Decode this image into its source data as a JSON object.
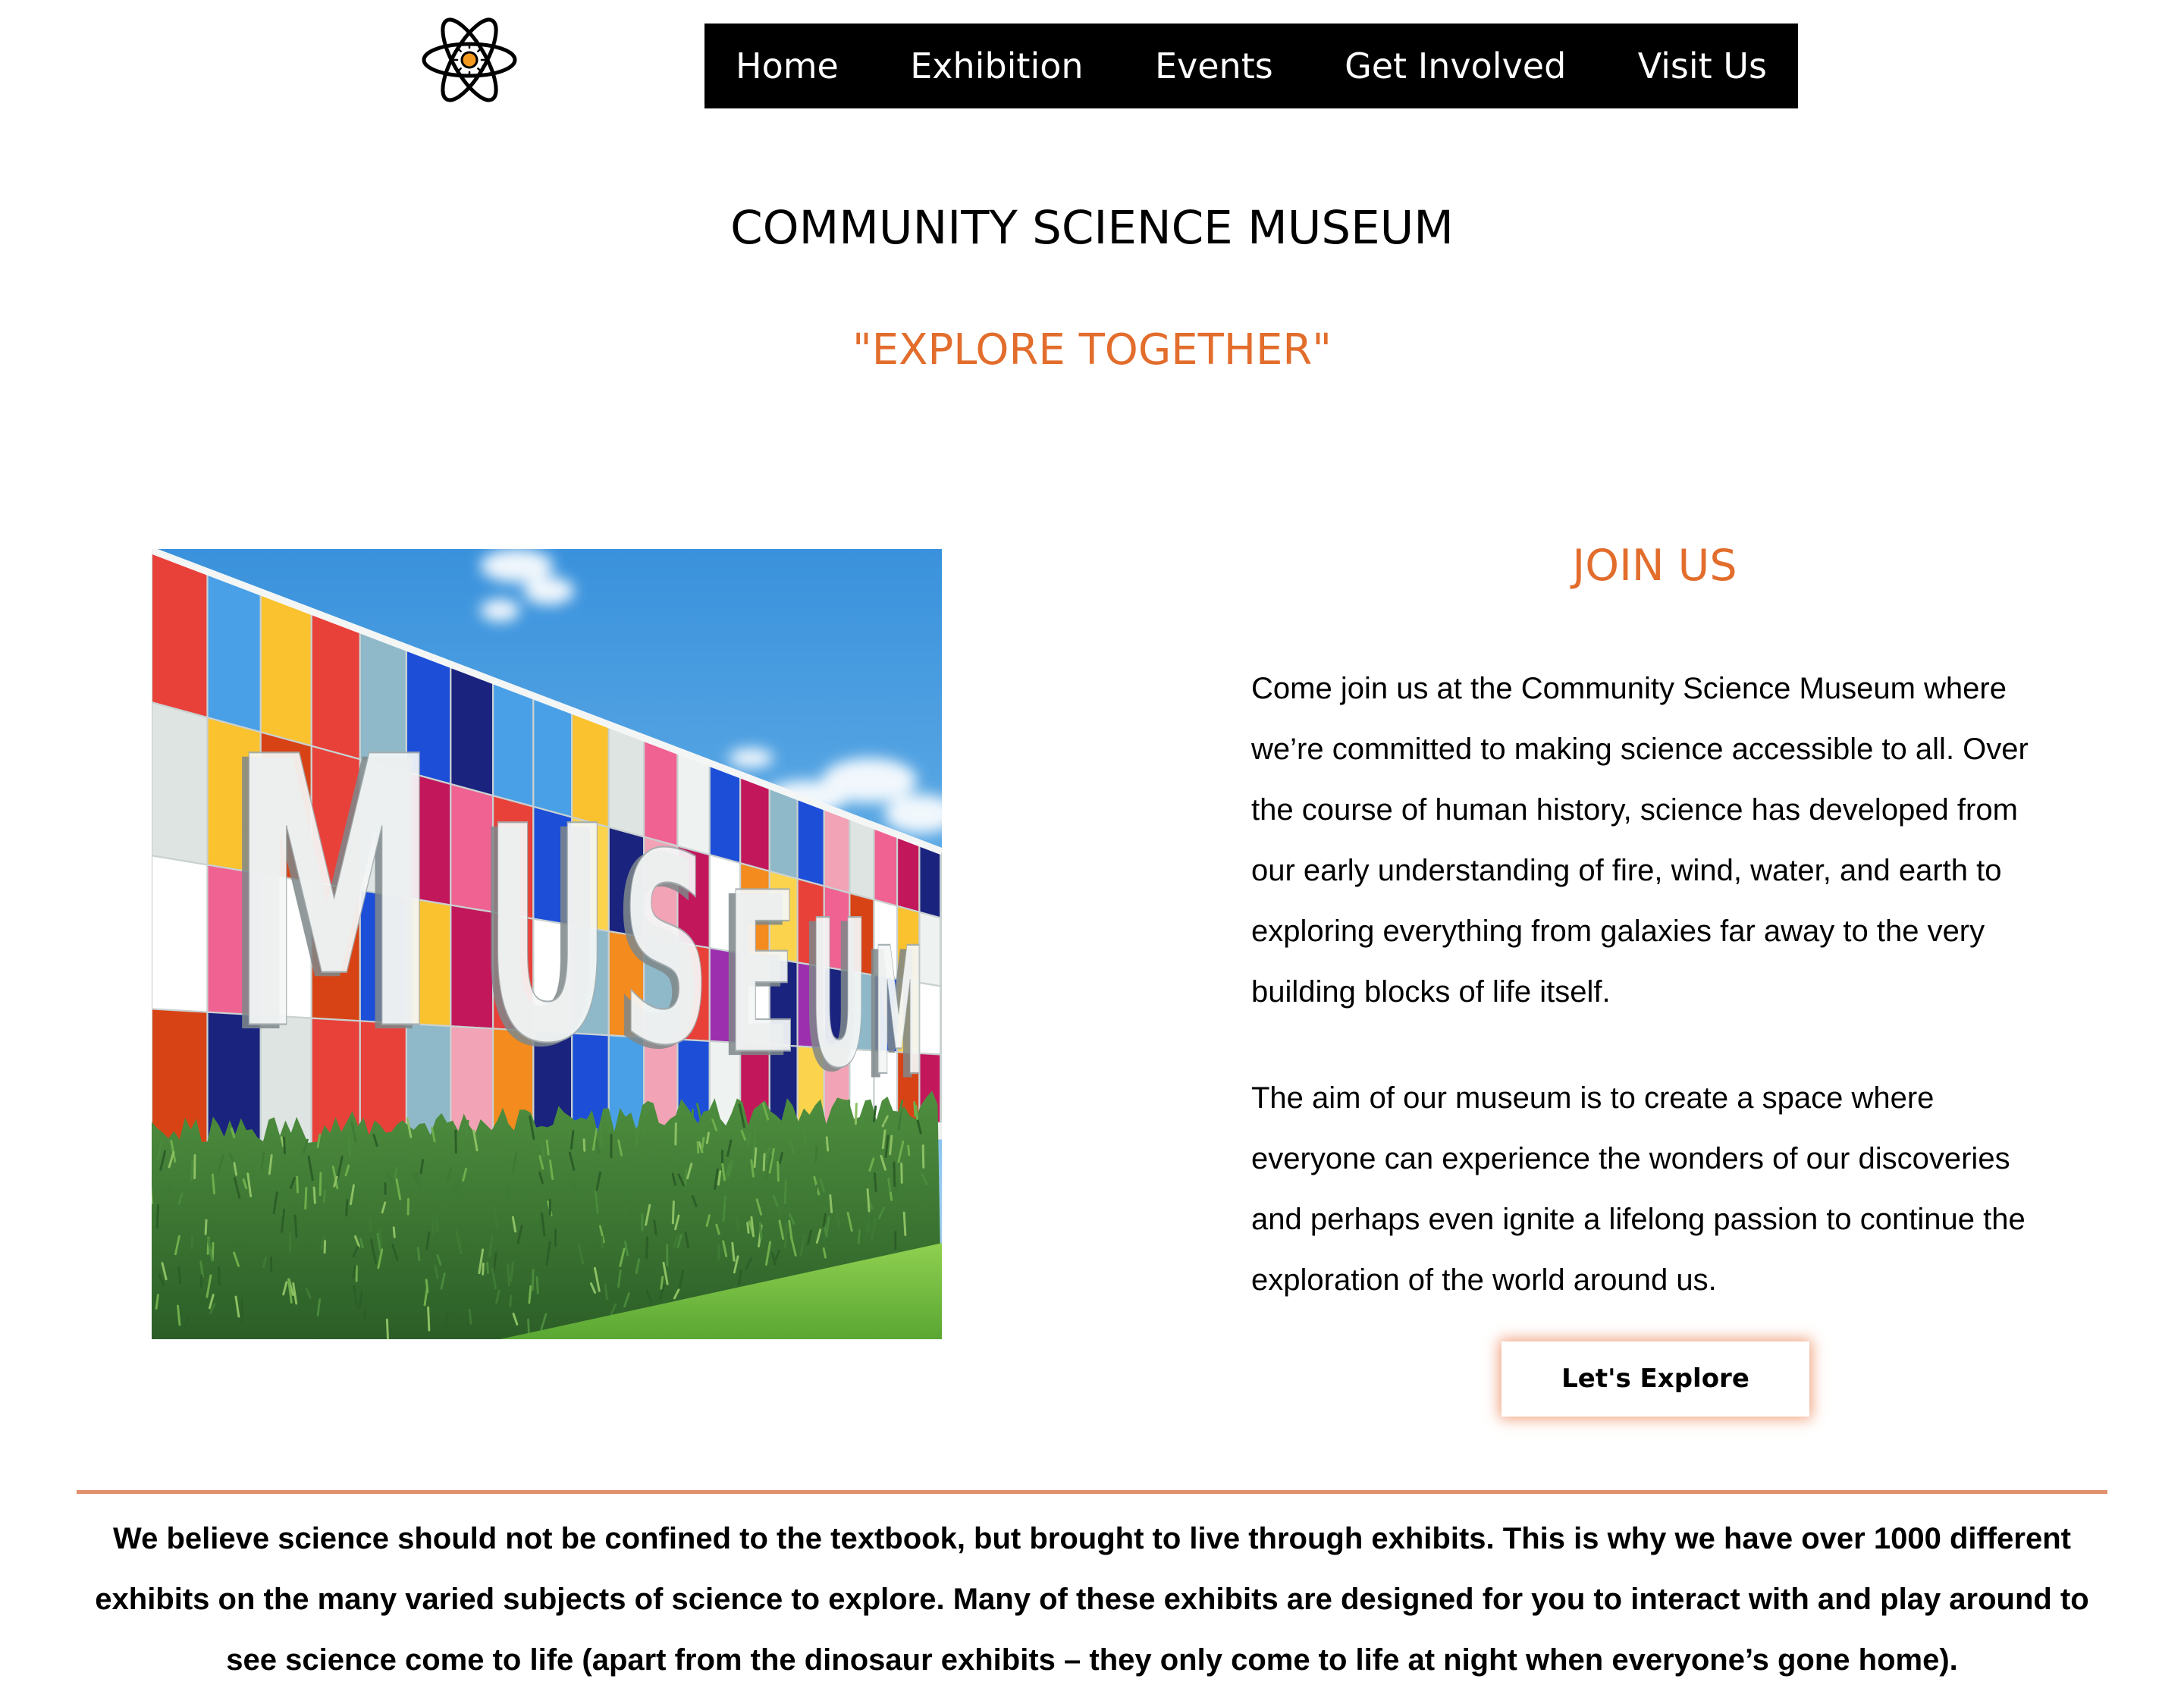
{
  "theme": {
    "accent": "#E26D2C",
    "nav_bg": "#000000",
    "nav_text": "#FFFFFF",
    "divider": "#E0906B",
    "button_glow": "#F0A07C",
    "text": "#000000"
  },
  "header": {
    "logo": {
      "icon": "atom-icon"
    },
    "nav": [
      {
        "label": "Home"
      },
      {
        "label": "Exhibition"
      },
      {
        "label": "Events"
      },
      {
        "label": "Get Involved"
      },
      {
        "label": "Visit Us"
      }
    ]
  },
  "hero": {
    "title": "COMMUNITY SCIENCE MUSEUM",
    "tagline": "\"EXPLORE TOGETHER\""
  },
  "join": {
    "image": {
      "lettering": "MUSEUM"
    },
    "heading": "JOIN US",
    "paragraphs": [
      {
        "lines": [
          "Come join us at the Community Science Museum where",
          "we’re committed to making science accessible to all. Over",
          "the course of human history, science has developed from",
          "our early understanding of fire, wind, water, and earth to",
          "exploring everything from galaxies far away to the very",
          "building blocks of life itself."
        ]
      },
      {
        "lines": [
          "The aim of our museum is to create a space where",
          "everyone can experience the wonders of our discoveries",
          "and perhaps even ignite a lifelong passion to continue the",
          "exploration of the world around us."
        ]
      }
    ],
    "button_label": "Let's Explore"
  },
  "mission": {
    "lines": [
      "We believe science should not be confined to the textbook, but brought to live through exhibits. This is why we have over 1000 different",
      "exhibits on the many varied subjects of science to explore. Many of these exhibits are designed for you to interact with and play around to",
      "see science come to life (apart from the dinosaur exhibits – they only come to life at night when everyone’s gone home)."
    ]
  }
}
